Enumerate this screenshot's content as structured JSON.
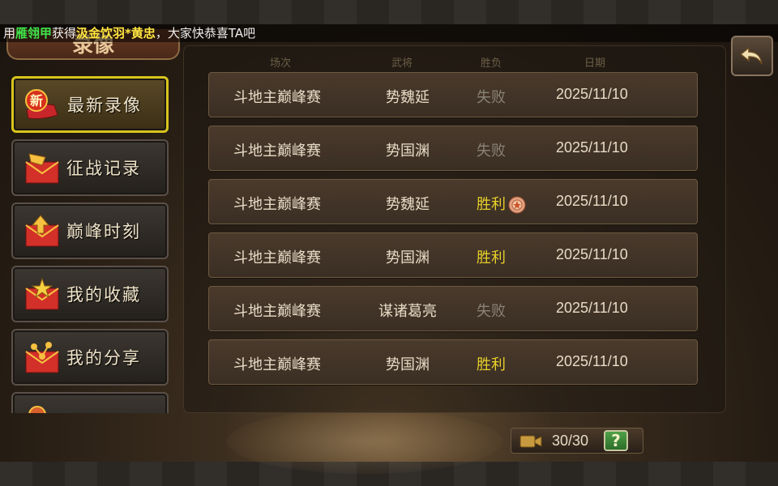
{
  "marquee": {
    "prefix": "用",
    "item": "雁翎甲",
    "verb": "获得",
    "reward": "汲金饮羽*黄忠",
    "suffix": "，大家快恭喜TA吧"
  },
  "title": "录像",
  "back_icon": "back-arrow-icon",
  "sidebar": {
    "items": [
      {
        "label": "最新录像",
        "icon": "new-badge-icon",
        "active": true
      },
      {
        "label": "征战记录",
        "icon": "flag-envelope-icon",
        "active": false
      },
      {
        "label": "巅峰时刻",
        "icon": "arrow-envelope-icon",
        "active": false
      },
      {
        "label": "我的收藏",
        "icon": "star-envelope-icon",
        "active": false
      },
      {
        "label": "我的分享",
        "icon": "share-envelope-icon",
        "active": false
      },
      {
        "label": "",
        "icon": "partial-envelope-icon",
        "active": false
      }
    ]
  },
  "table": {
    "headers": [
      "场次",
      "武将",
      "胜负",
      "日期"
    ],
    "rows": [
      {
        "mode": "斗地主巅峰赛",
        "general": "势魏延",
        "result": "失败",
        "date": "2025/11/10",
        "win": false,
        "medal": false
      },
      {
        "mode": "斗地主巅峰赛",
        "general": "势国渊",
        "result": "失败",
        "date": "2025/11/10",
        "win": false,
        "medal": false
      },
      {
        "mode": "斗地主巅峰赛",
        "general": "势魏延",
        "result": "胜利",
        "date": "2025/11/10",
        "win": true,
        "medal": true
      },
      {
        "mode": "斗地主巅峰赛",
        "general": "势国渊",
        "result": "胜利",
        "date": "2025/11/10",
        "win": true,
        "medal": false
      },
      {
        "mode": "斗地主巅峰赛",
        "general": "谋诸葛亮",
        "result": "失败",
        "date": "2025/11/10",
        "win": false,
        "medal": false
      },
      {
        "mode": "斗地主巅峰赛",
        "general": "势国渊",
        "result": "胜利",
        "date": "2025/11/10",
        "win": true,
        "medal": false
      }
    ]
  },
  "counter": {
    "text": "30/30",
    "help": "?",
    "icon": "video-camera-icon"
  },
  "colors": {
    "win": "#e8d02a",
    "lose": "#8a8276",
    "active_border": "#d8c41c"
  }
}
